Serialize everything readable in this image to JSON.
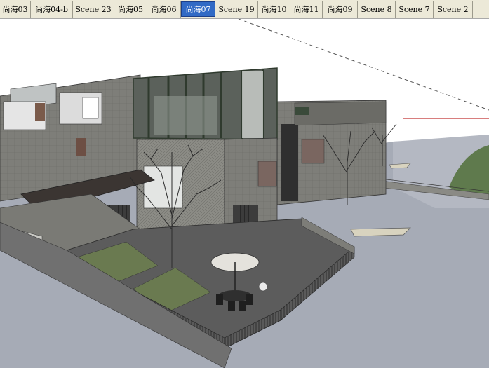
{
  "scene_tabs": {
    "active_index": 5,
    "active_color": "#316ac5",
    "items": [
      {
        "label": "尚海03"
      },
      {
        "label": "尚海04-b"
      },
      {
        "label": "Scene 23"
      },
      {
        "label": "尚海05"
      },
      {
        "label": "尚海06"
      },
      {
        "label": "尚海07"
      },
      {
        "label": "Scene 19"
      },
      {
        "label": "尚海10"
      },
      {
        "label": "尚海11"
      },
      {
        "label": "尚海09"
      },
      {
        "label": "Scene 8"
      },
      {
        "label": "Scene 7"
      },
      {
        "label": "Scene 2"
      }
    ]
  },
  "viewport": {
    "content": "3D model view",
    "colors": {
      "water": "#a6abb6",
      "lawn": "#6a7a50",
      "wall": "#8e8e88",
      "deck": "#5c5c5c",
      "frame": "#2f3a2e"
    }
  }
}
